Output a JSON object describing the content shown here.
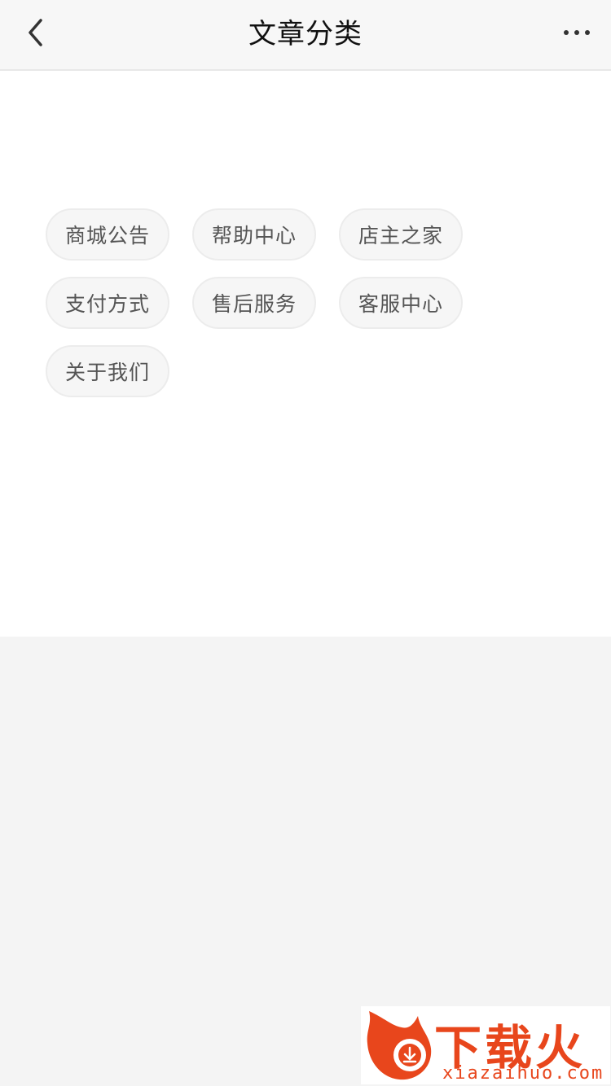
{
  "header": {
    "title": "文章分类",
    "back_icon": "chevron-left-icon",
    "more_icon": "ellipsis-icon"
  },
  "categories": [
    [
      "商城公告",
      "帮助中心",
      "店主之家"
    ],
    [
      "支付方式",
      "售后服务",
      "客服中心"
    ],
    [
      "关于我们"
    ]
  ],
  "watermark": {
    "brand": "下载火",
    "domain": "xiazaihuo.com"
  },
  "colors": {
    "accent": "#e8461c",
    "tag_bg": "#f6f6f6",
    "tag_text": "#555555"
  }
}
